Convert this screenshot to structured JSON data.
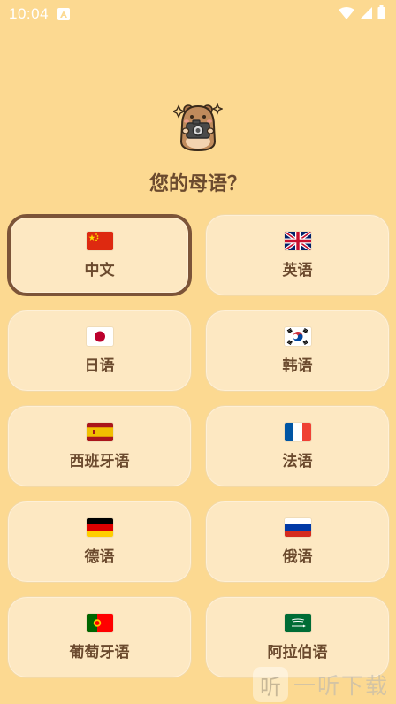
{
  "status_bar": {
    "time": "10:04"
  },
  "header": {
    "title": "您的母语？"
  },
  "languages": [
    {
      "label": "中文",
      "flag": "china-flag-icon",
      "selected": true
    },
    {
      "label": "英语",
      "flag": "uk-flag-icon",
      "selected": false
    },
    {
      "label": "日语",
      "flag": "japan-flag-icon",
      "selected": false
    },
    {
      "label": "韩语",
      "flag": "korea-flag-icon",
      "selected": false
    },
    {
      "label": "西班牙语",
      "flag": "spain-flag-icon",
      "selected": false
    },
    {
      "label": "法语",
      "flag": "france-flag-icon",
      "selected": false
    },
    {
      "label": "德语",
      "flag": "germany-flag-icon",
      "selected": false
    },
    {
      "label": "俄语",
      "flag": "russia-flag-icon",
      "selected": false
    },
    {
      "label": "葡萄牙语",
      "flag": "portugal-flag-icon",
      "selected": false
    },
    {
      "label": "阿拉伯语",
      "flag": "saudi-arabia-flag-icon",
      "selected": false
    }
  ],
  "watermark": {
    "text": "一听下载",
    "logo_glyph": "听"
  },
  "colors": {
    "background": "#FCD991",
    "card": "#FDE8C2",
    "selected_border": "#7C5438",
    "text": "#6B4A2E"
  }
}
